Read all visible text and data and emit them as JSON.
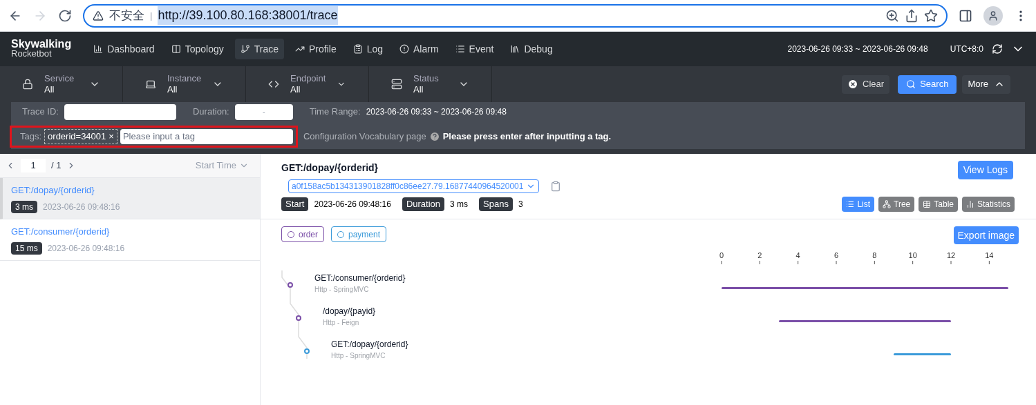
{
  "browser": {
    "security": "不安全",
    "separator": "|",
    "url": "http://39.100.80.168:38001/trace"
  },
  "nav": {
    "logo_top": "Skywalking",
    "logo_bottom": "Rocketbot",
    "items": [
      {
        "label": "Dashboard",
        "selected": false
      },
      {
        "label": "Topology",
        "selected": false
      },
      {
        "label": "Trace",
        "selected": true
      },
      {
        "label": "Profile",
        "selected": false
      },
      {
        "label": "Log",
        "selected": false
      },
      {
        "label": "Alarm",
        "selected": false
      },
      {
        "label": "Event",
        "selected": false
      },
      {
        "label": "Debug",
        "selected": false
      }
    ],
    "time_range": "2023-06-26 09:33 ~ 2023-06-26 09:48",
    "timezone": "UTC+8:0"
  },
  "filters": [
    {
      "label": "Service",
      "value": "All"
    },
    {
      "label": "Instance",
      "value": "All"
    },
    {
      "label": "Endpoint",
      "value": "All"
    },
    {
      "label": "Status",
      "value": "All"
    }
  ],
  "actions": {
    "clear": "Clear",
    "search": "Search",
    "more": "More"
  },
  "more_panel": {
    "trace_id_label": "Trace ID:",
    "duration_label": "Duration:",
    "duration_sep": "-",
    "time_range_label": "Time Range:",
    "time_range": "2023-06-26 09:33 ~ 2023-06-26 09:48",
    "tags_label": "Tags:",
    "tag": "orderid=34001",
    "tag_remove": "×",
    "tag_placeholder": "Please input a tag",
    "vocab_link": "Configuration Vocabulary page",
    "hint": "Please press enter after inputting a tag."
  },
  "list": {
    "page": "1",
    "total": "/ 1",
    "sort": "Start Time",
    "traces": [
      {
        "endpoint": "GET:/dopay/{orderid}",
        "duration": "3 ms",
        "start": "2023-06-26 09:48:16",
        "selected": true
      },
      {
        "endpoint": "GET:/consumer/{orderid}",
        "duration": "15 ms",
        "start": "2023-06-26 09:48:16",
        "selected": false
      }
    ]
  },
  "detail": {
    "title": "GET:/dopay/{orderid}",
    "view_logs": "View Logs",
    "trace_id": "a0f158ac5b134313901828ff0c86ee27.79.16877440964520001",
    "start_label": "Start",
    "start": "2023-06-26 09:48:16",
    "duration_label": "Duration",
    "duration": "3 ms",
    "spans_label": "Spans",
    "spans": "3",
    "views": [
      {
        "label": "List",
        "selected": true
      },
      {
        "label": "Tree",
        "selected": false
      },
      {
        "label": "Table",
        "selected": false
      },
      {
        "label": "Statistics",
        "selected": false
      }
    ],
    "services": [
      {
        "name": "order",
        "color": "#7b4fa8"
      },
      {
        "name": "payment",
        "color": "#3a9ad9"
      }
    ],
    "export": "Export image",
    "spans_list": [
      {
        "name": "GET:/consumer/{orderid}",
        "component": "Http - SpringMVC",
        "color": "#7b4fa8",
        "children": [
          {
            "name": "/dopay/{payid}",
            "component": "Http - Feign",
            "color": "#7b4fa8",
            "children": [
              {
                "name": "GET:/dopay/{orderid}",
                "component": "Http - SpringMVC",
                "color": "#3a9ad9"
              }
            ]
          }
        ]
      }
    ],
    "timeline_ticks": [
      "0",
      "2",
      "4",
      "6",
      "8",
      "10",
      "12",
      "14"
    ]
  }
}
